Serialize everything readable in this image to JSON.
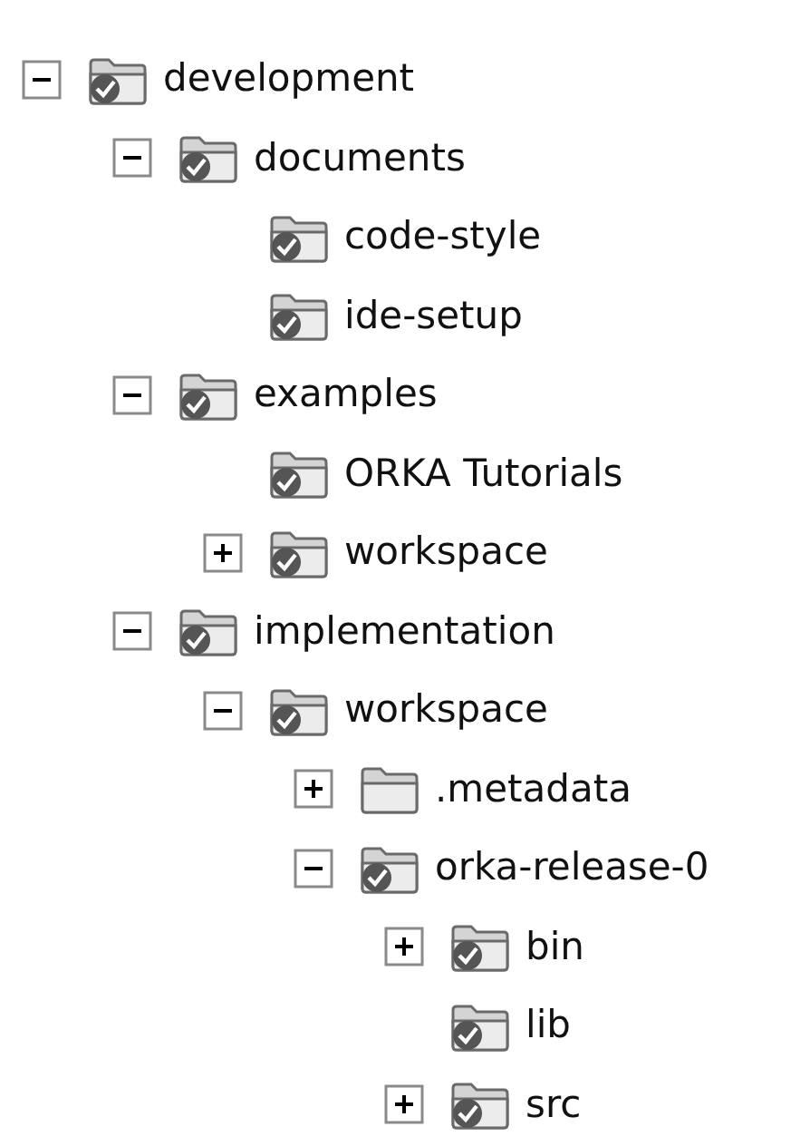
{
  "tree": [
    {
      "label": "development",
      "expanded": true,
      "versioned": true,
      "children": [
        {
          "label": "documents",
          "expanded": true,
          "versioned": true,
          "children": [
            {
              "label": "code-style",
              "versioned": true
            },
            {
              "label": "ide-setup",
              "versioned": true
            }
          ]
        },
        {
          "label": "examples",
          "expanded": true,
          "versioned": true,
          "children": [
            {
              "label": "ORKA Tutorials",
              "versioned": true
            },
            {
              "label": "workspace",
              "expanded": false,
              "versioned": true
            }
          ]
        },
        {
          "label": "implementation",
          "expanded": true,
          "versioned": true,
          "children": [
            {
              "label": "workspace",
              "expanded": true,
              "versioned": true,
              "children": [
                {
                  "label": ".metadata",
                  "expanded": false,
                  "versioned": false
                },
                {
                  "label": "orka-release-0",
                  "expanded": true,
                  "versioned": true,
                  "children": [
                    {
                      "label": "bin",
                      "expanded": false,
                      "versioned": true
                    },
                    {
                      "label": "lib",
                      "versioned": true
                    },
                    {
                      "label": "src",
                      "expanded": false,
                      "versioned": true
                    }
                  ]
                }
              ]
            }
          ]
        }
      ]
    }
  ]
}
